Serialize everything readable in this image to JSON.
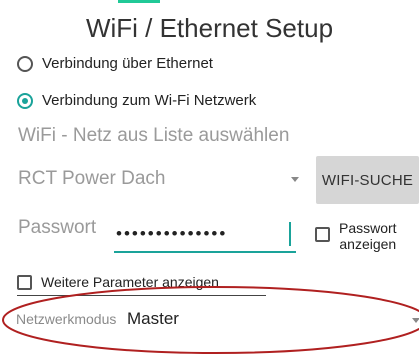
{
  "title": "WiFi / Ethernet Setup",
  "connection_options": [
    {
      "label": "Verbindung über Ethernet",
      "checked": false
    },
    {
      "label": "Verbindung zum Wi-Fi Netzwerk",
      "checked": true
    }
  ],
  "wifi_list_label": "WiFi - Netz aus Liste auswählen",
  "network_spinner_value": "RCT Power Dach",
  "wifi_search_button": "WIFI-SUCHE",
  "password": {
    "hint": "Passwort",
    "value": "••••••••••••••",
    "show_label_line1": "Passwort",
    "show_label_line2": "anzeigen",
    "show_checked": false
  },
  "more_parameters": {
    "label": "Weitere Parameter anzeigen",
    "checked": false
  },
  "network_mode": {
    "key": "Netzwerkmodus",
    "value": "Master"
  },
  "colors": {
    "accent": "#1aa39a",
    "highlight_ellipse": "#b02020",
    "topbar": "#20c997"
  }
}
